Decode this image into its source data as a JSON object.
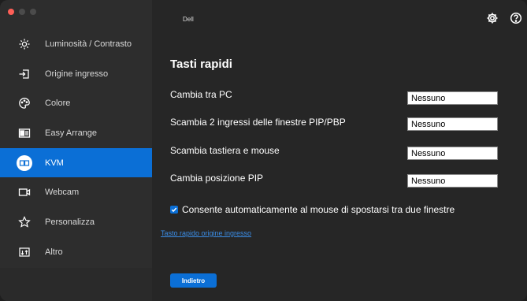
{
  "window": {
    "brand": "Dell"
  },
  "header": {
    "settings_icon": "gear-icon",
    "help_icon": "help-icon"
  },
  "sidebar": {
    "items": [
      {
        "label": "Luminosità / Contrasto",
        "icon": "brightness-icon"
      },
      {
        "label": "Origine ingresso",
        "icon": "input-source-icon"
      },
      {
        "label": "Colore",
        "icon": "color-icon"
      },
      {
        "label": "Easy Arrange",
        "icon": "easy-arrange-icon"
      },
      {
        "label": "KVM",
        "icon": "kvm-icon",
        "active": true
      },
      {
        "label": "Webcam",
        "icon": "webcam-icon"
      },
      {
        "label": "Personalizza",
        "icon": "star-icon"
      },
      {
        "label": "Altro",
        "icon": "other-icon"
      }
    ]
  },
  "main": {
    "title": "Tasti rapidi",
    "rows": [
      {
        "label": "Cambia tra PC",
        "value": "Nessuno"
      },
      {
        "label": "Scambia 2 ingressi delle finestre PIP/PBP",
        "value": "Nessuno"
      },
      {
        "label": "Scambia tastiera e mouse",
        "value": "Nessuno"
      },
      {
        "label": "Cambia posizione PIP",
        "value": "Nessuno"
      }
    ],
    "checkbox_label": "Consente automaticamente al mouse di spostarsi tra due finestre",
    "checkbox_checked": true,
    "link_label": "Tasto rapido origine ingresso",
    "back_label": "Indietro"
  },
  "colors": {
    "accent": "#0b6fd6",
    "sidebar": "#2d2d2d",
    "background": "#262626",
    "link": "#3b8de6"
  }
}
